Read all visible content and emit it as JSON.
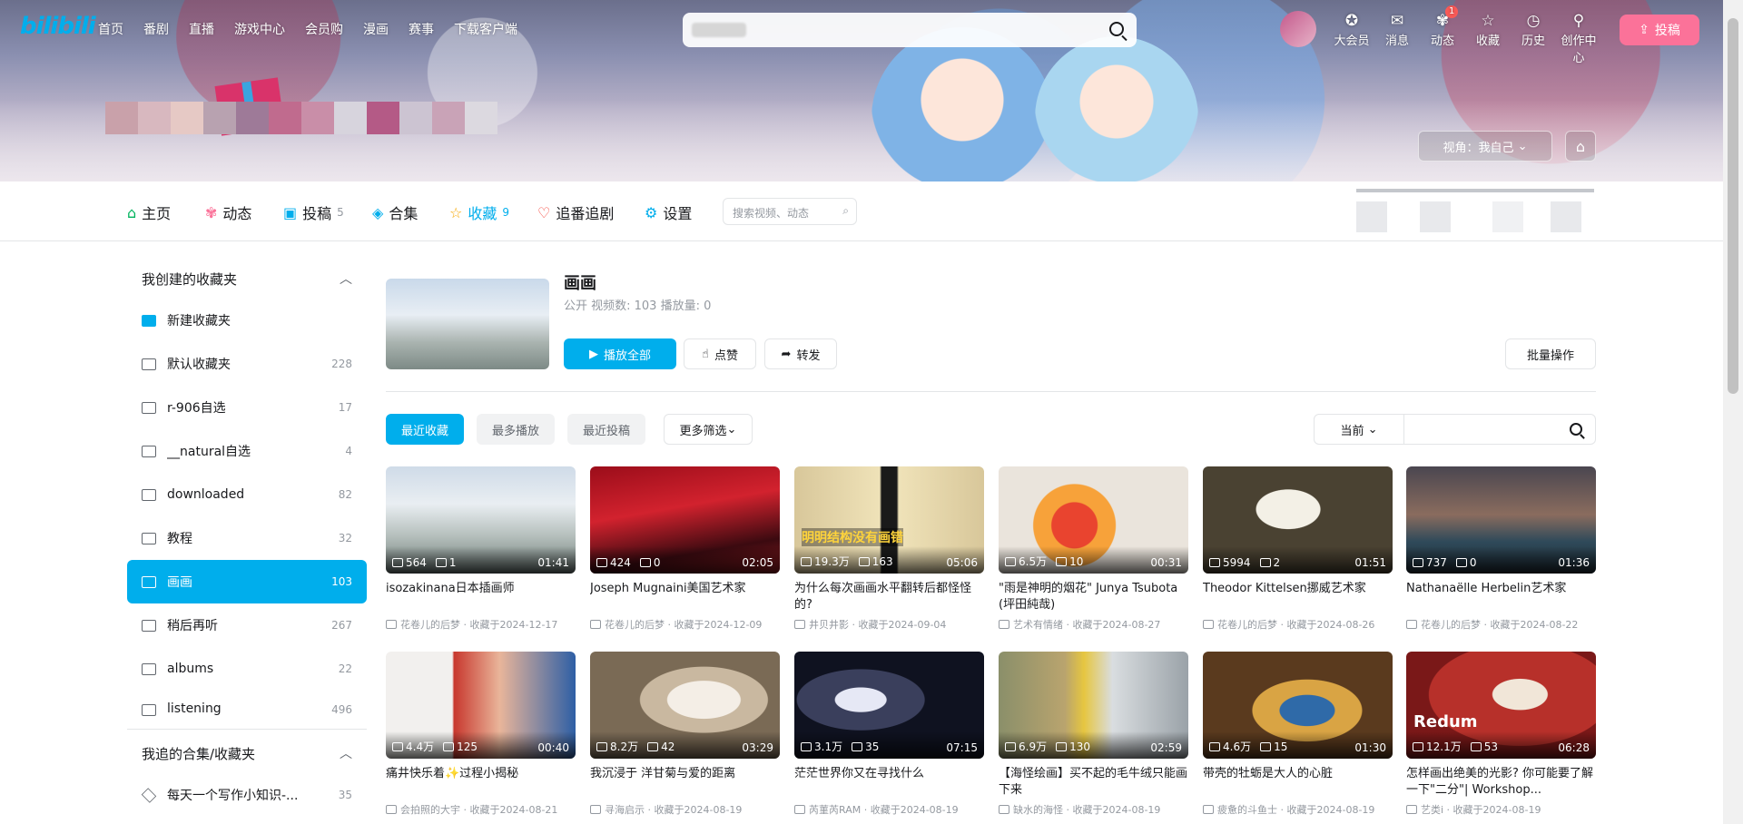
{
  "header": {
    "logo": "bilibili",
    "nav": [
      "首页",
      "番剧",
      "直播",
      "游戏中心",
      "会员购",
      "漫画",
      "赛事",
      "下载客户端"
    ],
    "right_icons": [
      {
        "icon": "vip-icon",
        "label": "大会员"
      },
      {
        "icon": "message-icon",
        "label": "消息"
      },
      {
        "icon": "dynamic-icon",
        "label": "动态",
        "badge": "1"
      },
      {
        "icon": "star-icon",
        "label": "收藏"
      },
      {
        "icon": "clock-icon",
        "label": "历史"
      },
      {
        "icon": "bulb-icon",
        "label": "创作中心"
      }
    ],
    "upload_label": "投稿",
    "view_label": "视角：我自己"
  },
  "tabs": {
    "items": [
      {
        "label": "主页",
        "icon": "home-icon",
        "color": "#00b35d"
      },
      {
        "label": "动态",
        "icon": "dynamic-icon",
        "color": "#fb7299"
      },
      {
        "label": "投稿",
        "icon": "tv-icon",
        "count": "5",
        "color": "#00aeec"
      },
      {
        "label": "合集",
        "icon": "layers-icon",
        "color": "#00aeec"
      },
      {
        "label": "收藏",
        "icon": "star-icon",
        "count": "9",
        "color": "#f6a700"
      },
      {
        "label": "追番追剧",
        "icon": "heart-icon",
        "color": "#f5443b"
      },
      {
        "label": "设置",
        "icon": "gear-icon",
        "color": "#00aeec"
      }
    ],
    "search_placeholder": "搜索视频、动态"
  },
  "sidebar": {
    "created_title": "我创建的收藏夹",
    "items": [
      {
        "name": "新建收藏夹",
        "count": ""
      },
      {
        "name": "默认收藏夹",
        "count": "228"
      },
      {
        "name": "r-906自选",
        "count": "17"
      },
      {
        "name": "__natural自选",
        "count": "4"
      },
      {
        "name": "downloaded",
        "count": "82"
      },
      {
        "name": "教程",
        "count": "32"
      },
      {
        "name": "画画",
        "count": "103"
      },
      {
        "name": "稍后再听",
        "count": "267"
      },
      {
        "name": "albums",
        "count": "22"
      },
      {
        "name": "listening",
        "count": "496"
      }
    ],
    "followed_title": "我追的合集/收藏夹",
    "followed_items": [
      {
        "name": "每天一个写作小知识-...",
        "count": "35"
      }
    ]
  },
  "folder": {
    "title": "画画",
    "meta": "公开   视频数: 103   播放量: 0",
    "play_all": "播放全部",
    "like": "点赞",
    "share": "转发",
    "batch": "批量操作"
  },
  "filters": {
    "recent_fav": "最近收藏",
    "most_play": "最多播放",
    "recent_upload": "最近投稿",
    "more": "更多筛选",
    "current": "当前"
  },
  "videos": [
    {
      "title": "isozakinana日本插画师",
      "plays": "564",
      "danmaku": "1",
      "duration": "01:41",
      "meta": "花卷儿的后梦 · 收藏于2024-12-17",
      "caption": ""
    },
    {
      "title": "Joseph Mugnaini美国艺术家",
      "plays": "424",
      "danmaku": "0",
      "duration": "02:05",
      "meta": "花卷儿的后梦 · 收藏于2024-12-09",
      "caption": ""
    },
    {
      "title": "为什么每次画画水平翻转后都怪怪的?",
      "plays": "19.3万",
      "danmaku": "163",
      "duration": "05:06",
      "meta": "井贝井影 · 收藏于2024-09-04",
      "caption": "明明结构没有画错"
    },
    {
      "title": "\"雨是神明的烟花\" Junya Tsubota (坪田純哉)",
      "plays": "6.5万",
      "danmaku": "10",
      "duration": "00:31",
      "meta": "艺术有情绪 · 收藏于2024-08-27",
      "caption": ""
    },
    {
      "title": "Theodor Kittelsen挪威艺术家",
      "plays": "5994",
      "danmaku": "2",
      "duration": "01:51",
      "meta": "花卷儿的后梦 · 收藏于2024-08-26",
      "caption": ""
    },
    {
      "title": "Nathanaëlle Herbelin艺术家",
      "plays": "737",
      "danmaku": "0",
      "duration": "01:36",
      "meta": "花卷儿的后梦 · 收藏于2024-08-22",
      "caption": ""
    },
    {
      "title": "痛井快乐着✨过程小揭秘",
      "plays": "4.4万",
      "danmaku": "125",
      "duration": "00:40",
      "meta": "会拍照的大宇 · 收藏于2024-08-21",
      "caption": ""
    },
    {
      "title": "我沉浸于 洋甘菊与爱的距离",
      "plays": "8.2万",
      "danmaku": "42",
      "duration": "03:29",
      "meta": "寻海启示 · 收藏于2024-08-19",
      "caption": ""
    },
    {
      "title": "茫茫世界你又在寻找什么",
      "plays": "3.1万",
      "danmaku": "35",
      "duration": "07:15",
      "meta": "芮菫芮RAM · 收藏于2024-08-19",
      "caption": ""
    },
    {
      "title": "【海怪绘画】买不起的毛牛绒只能画下来",
      "plays": "6.9万",
      "danmaku": "130",
      "duration": "02:59",
      "meta": "缺水的海怪 · 收藏于2024-08-19",
      "caption": ""
    },
    {
      "title": "带壳的牡蛎是大人的心脏",
      "plays": "4.6万",
      "danmaku": "15",
      "duration": "01:30",
      "meta": "疲惫的斗鱼士 · 收藏于2024-08-19",
      "caption": ""
    },
    {
      "title": "怎样画出绝美的光影? 你可能要了解一下\"二分\"| Workshop...",
      "plays": "12.1万",
      "danmaku": "53",
      "duration": "06:28",
      "meta": "艺类i · 收藏于2024-08-19",
      "caption": "Redum"
    }
  ]
}
